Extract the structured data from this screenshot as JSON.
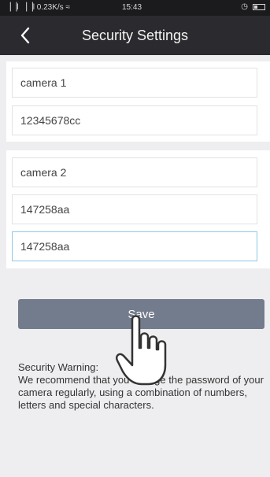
{
  "status_bar": {
    "signal": "▕▕l ▕▕l 0.23K/s ≈",
    "time": "15:43",
    "alarm_icon": "alarm-icon",
    "battery_icon": "battery-icon"
  },
  "header": {
    "back_icon": "chevron-left-icon",
    "title": "Security Settings"
  },
  "section1": {
    "name_value": "camera 1",
    "password_value": "12345678cc"
  },
  "section2": {
    "name_value": "camera 2",
    "password_value": "147258aa",
    "confirm_value": "147258aa"
  },
  "save_label": "Save",
  "warning": {
    "title": "Security Warning:",
    "body": "We recommend that you change the password of your camera regularly, using a combination of numbers, letters and special characters."
  },
  "colors": {
    "header_bg": "#2b2b2f",
    "save_bg": "#737c8c",
    "focus_border": "#8ec8e8"
  }
}
